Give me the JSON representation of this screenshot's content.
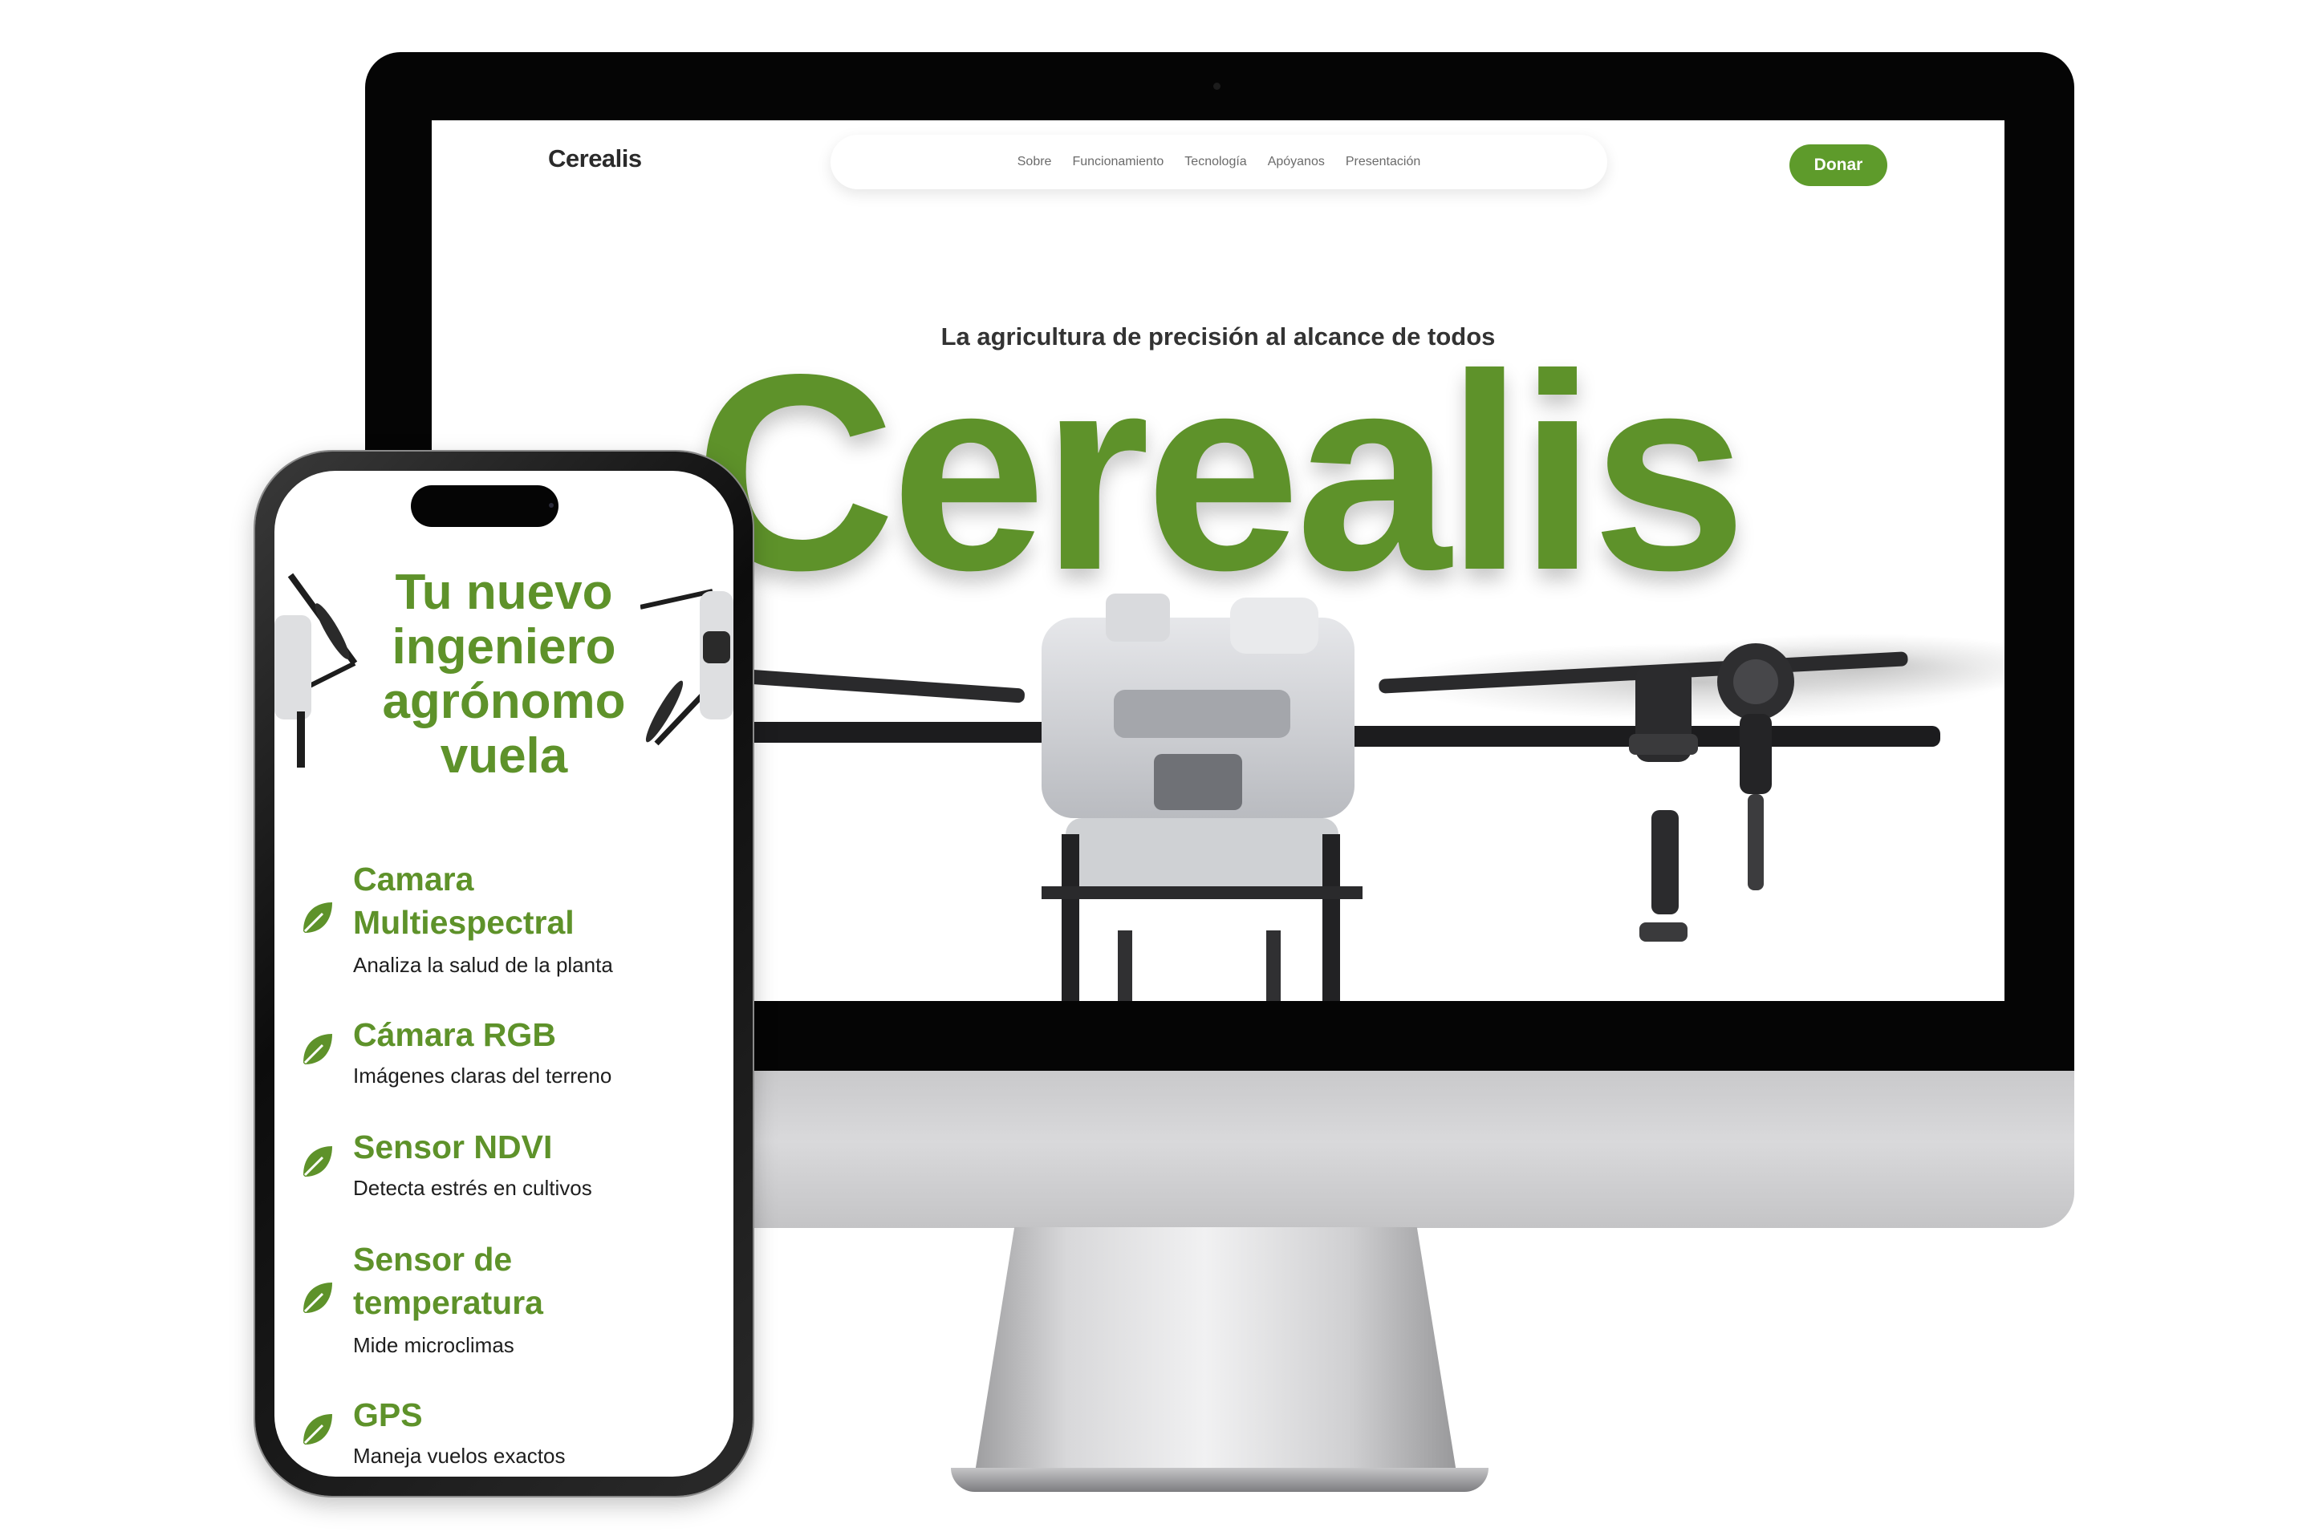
{
  "desktop": {
    "logo": "Cerealis",
    "nav": [
      "Sobre",
      "Funcionamiento",
      "Tecnología",
      "Apóyanos",
      "Presentación"
    ],
    "donate_label": "Donar",
    "tagline": "La agricultura de precisión al alcance de todos",
    "hero_word": "Cerealis"
  },
  "mobile": {
    "title_lines": [
      "Tu nuevo",
      "ingeniero",
      "agrónomo",
      "vuela"
    ],
    "features": [
      {
        "title_lines": [
          "Camara",
          "Multiespectral"
        ],
        "desc": "Analiza la salud de la planta",
        "icon": "leaf-icon"
      },
      {
        "title_lines": [
          "Cámara RGB"
        ],
        "desc": "Imágenes claras del terreno",
        "icon": "leaf-icon"
      },
      {
        "title_lines": [
          "Sensor NDVI"
        ],
        "desc": "Detecta estrés en cultivos",
        "icon": "leaf-icon"
      },
      {
        "title_lines": [
          "Sensor de",
          "temperatura"
        ],
        "desc": "Mide microclimas",
        "icon": "leaf-icon"
      },
      {
        "title_lines": [
          "GPS"
        ],
        "desc": "Maneja vuelos exactos",
        "icon": "leaf-icon"
      }
    ]
  },
  "colors": {
    "brand_green": "#5e922a",
    "button_green": "#5e9b2b",
    "text_dark": "#2b2b2b"
  }
}
